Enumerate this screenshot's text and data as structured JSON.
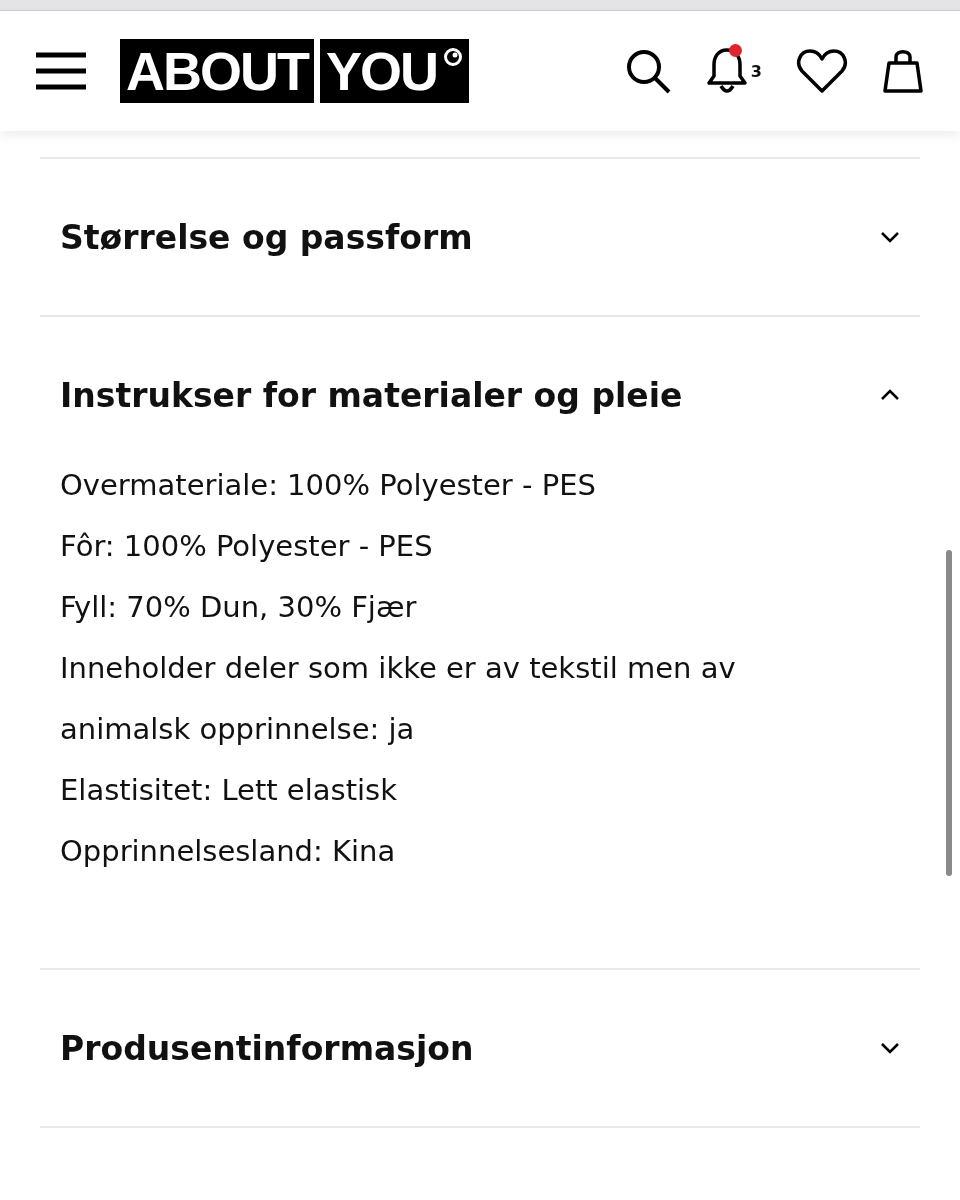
{
  "header": {
    "logo": [
      "ABOUT",
      "YOU"
    ],
    "notification_count": "3",
    "unread": true
  },
  "sections": [
    {
      "title": "Størrelse og passform",
      "expanded": false
    },
    {
      "title": "Instrukser for materialer og pleie",
      "expanded": true,
      "lines": [
        "Overmateriale: 100% Polyester - PES",
        "Fôr: 100% Polyester - PES",
        "Fyll: 70% Dun, 30% Fjær",
        "Inneholder deler som ikke er av tekstil men av animalsk opprinnelse: ja",
        "Elastisitet: Lett elastisk",
        "Opprinnelsesland: Kina"
      ]
    },
    {
      "title": "Produsentinformasjon",
      "expanded": false
    }
  ]
}
